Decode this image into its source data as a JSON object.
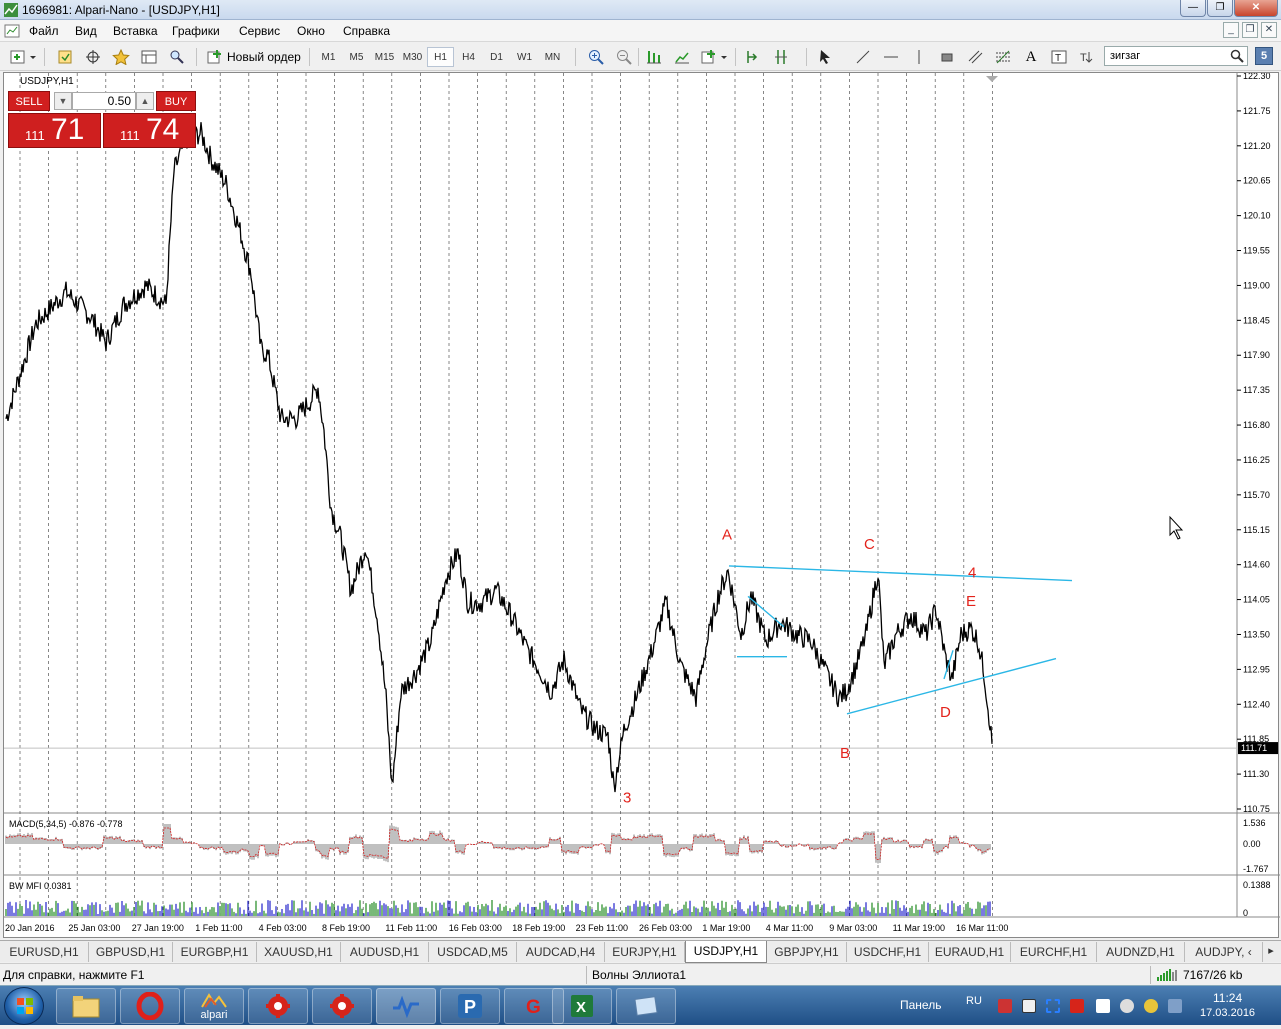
{
  "window": {
    "title": "1696981: Alpari-Nano - [USDJPY,H1]",
    "minimize": "—",
    "restore": "❐",
    "close": "✕"
  },
  "menu": [
    "Файл",
    "Вид",
    "Вставка",
    "Графики",
    "Сервис",
    "Окно",
    "Справка"
  ],
  "mdi": {
    "minimize": "_",
    "restore": "❐",
    "close": "✕"
  },
  "toolbar": {
    "new_order": "Новый ордер",
    "timeframes": [
      "M1",
      "M5",
      "M15",
      "M30",
      "H1",
      "H4",
      "D1",
      "W1",
      "MN"
    ],
    "active_timeframe": "H1",
    "search_value": "зигзаг"
  },
  "chart": {
    "symbol_label": "USDJPY,H1",
    "current_price": "111.71",
    "price_axis": [
      "122.30",
      "121.75",
      "121.20",
      "120.65",
      "120.10",
      "119.55",
      "119.00",
      "118.45",
      "117.90",
      "117.35",
      "116.80",
      "116.25",
      "115.70",
      "115.15",
      "114.60",
      "114.05",
      "113.50",
      "112.95",
      "112.40",
      "111.85",
      "111.30",
      "110.75"
    ],
    "time_axis": [
      "20 Jan 2016",
      "25 Jan 03:00",
      "27 Jan 19:00",
      "1 Feb 11:00",
      "4 Feb 03:00",
      "8 Feb 19:00",
      "11 Feb 11:00",
      "16 Feb 03:00",
      "18 Feb 19:00",
      "23 Feb 11:00",
      "26 Feb 03:00",
      "1 Mar 19:00",
      "4 Mar 11:00",
      "9 Mar 03:00",
      "11 Mar 19:00",
      "16 Mar 11:00"
    ],
    "wave_labels": [
      "A",
      "B",
      "C",
      "D",
      "E",
      "4",
      "3"
    ],
    "macd_label": "MACD(5,34,5) -0.876 -0.778",
    "macd_axis": [
      "1.536",
      "0.00",
      "-1.767"
    ],
    "bwmfi_label": "BW MFI 0.0381",
    "bwmfi_axis": [
      "0.1388",
      "0"
    ]
  },
  "trade_panel": {
    "sell_label": "SELL",
    "buy_label": "BUY",
    "lot": "0.50",
    "sell_small": "111",
    "sell_big": "71",
    "buy_small": "111",
    "buy_big": "74"
  },
  "symbol_tabs": [
    "EURUSD,H1",
    "GBPUSD,H1",
    "EURGBP,H1",
    "XAUUSD,H1",
    "AUDUSD,H1",
    "USDCAD,M5",
    "AUDCAD,H4",
    "EURJPY,H1",
    "USDJPY,H1",
    "GBPJPY,H1",
    "USDCHF,H1",
    "EURAUD,H1",
    "EURCHF,H1",
    "AUDNZD,H1",
    "AUDJPY, ‹"
  ],
  "active_symbol_tab": "USDJPY,H1",
  "status": {
    "help": "Для справки, нажмите F1",
    "profile": "Волны Эллиота1",
    "traffic": "7167/26 kb"
  },
  "taskbar": {
    "apps": [
      "explorer",
      "opera",
      "alpari",
      "app-red-1",
      "app-red-2",
      "app-chart",
      "app-p",
      "app-g",
      "excel",
      "app-window"
    ],
    "alpari_label": "alpari",
    "panel_label": "Панель",
    "lang": "RU",
    "time": "11:24",
    "date": "17.03.2016"
  },
  "colors": {
    "candle": "#000000",
    "trendline": "#2bb7e6",
    "wave_label": "#e3231c",
    "sell": "#d11f1f",
    "macd_hist": "#c0c0c0",
    "macd_signal": "#d11f1f",
    "bwmfi_up": "#1f8a1f",
    "bwmfi_down": "#2222cc"
  }
}
